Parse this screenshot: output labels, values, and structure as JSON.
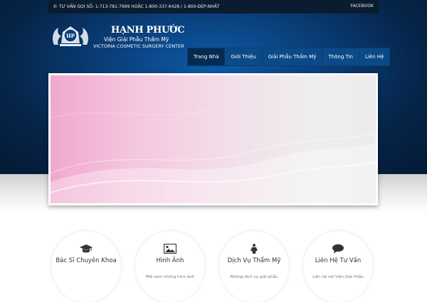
{
  "topbar": {
    "phone_text": "TƯ VẤN GỌI SỐ: 1-713-781-7999 HOẶC 1-800-337-6428 / 1-800-ĐẸP-NHẤT",
    "facebook_label": "FACEBOOK",
    "phone_icon": "phone-icon"
  },
  "brand": {
    "name": "HẠNH PHƯỚC",
    "subtitle": "Viện Giải Phẫu Thẩm Mỹ",
    "tagline": "VICTORIA COSMETIC SURGERY CENTER",
    "crest_text": "HP"
  },
  "nav": {
    "items": [
      {
        "label": "Trang Nhà",
        "active": true
      },
      {
        "label": "Giới Thiệu"
      },
      {
        "label": "Giải Phẫu Thẩm Mỹ"
      },
      {
        "label": "Thông Tin"
      },
      {
        "label": "Liên Hệ"
      }
    ]
  },
  "features": [
    {
      "title": "Bác Sĩ Chuyên Khoa",
      "desc": "",
      "icon": "graduation-cap-icon"
    },
    {
      "title": "Hình Ảnh",
      "desc": "Mời xem những hình ảnh",
      "icon": "picture-icon"
    },
    {
      "title": "Dịch Vụ Thẩm Mỹ",
      "desc": "Những dịch vụ giải phẫu",
      "icon": "female-icon"
    },
    {
      "title": "Liên Hệ Tư Vấn",
      "desc": "Liên hệ với Viện Giải Phẫu",
      "icon": "chat-bubble-icon"
    }
  ],
  "colors": {
    "header_dark": "#041a34",
    "header_mid": "#0d5aa8",
    "nav_bg": "#0b4a88",
    "nav_active": "#062b52",
    "slide_pink": "#f0a8cf"
  }
}
